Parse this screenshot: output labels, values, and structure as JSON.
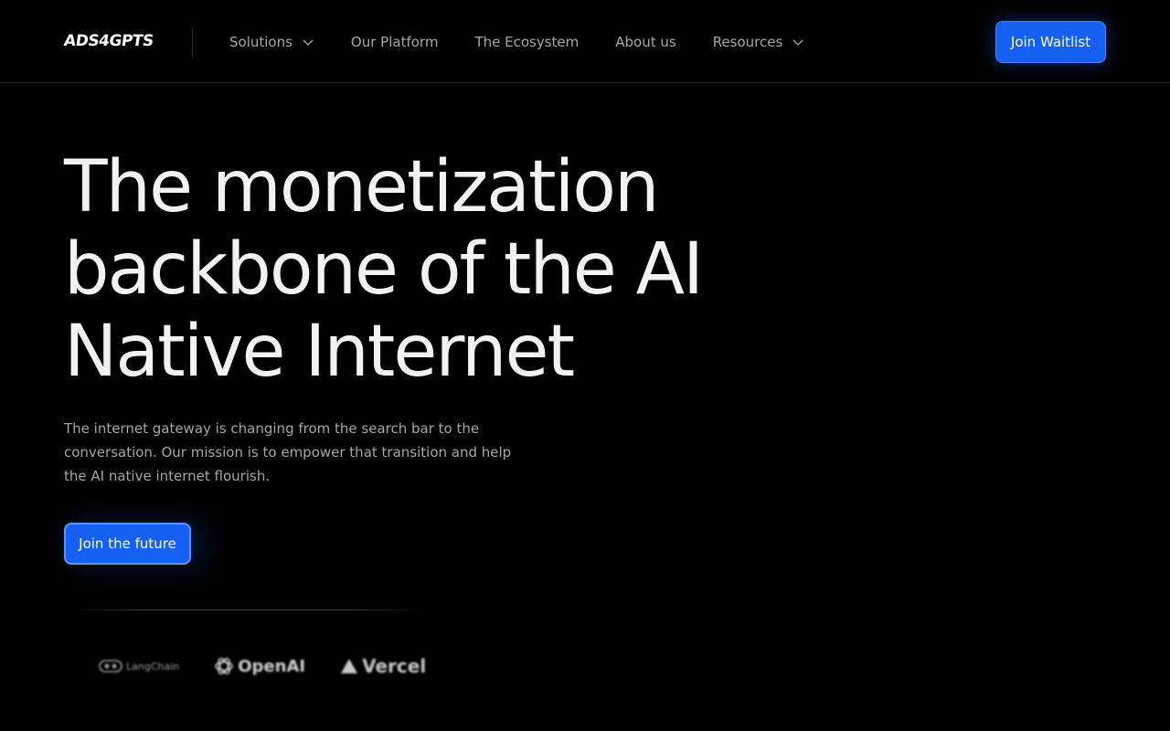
{
  "brand": {
    "logo_text": "ADS4GPTS",
    "accent_color": "#1560f3"
  },
  "nav": {
    "items": [
      {
        "label": "Solutions",
        "has_dropdown": true
      },
      {
        "label": "Our Platform",
        "has_dropdown": false
      },
      {
        "label": "The Ecosystem",
        "has_dropdown": false
      },
      {
        "label": "About us",
        "has_dropdown": false
      },
      {
        "label": "Resources",
        "has_dropdown": true
      }
    ],
    "cta_label": "Join Waitlist"
  },
  "hero": {
    "title_lines": [
      "The monetization",
      "backbone of the AI",
      "Native Internet"
    ],
    "subtitle": "The internet gateway is changing from the search bar to the conversation. Our mission is to empower that transition and help the AI native internet flourish.",
    "cta_label": "Join the future"
  },
  "partners": {
    "logos": [
      {
        "name": "LangChain",
        "icon": "langchain-icon"
      },
      {
        "name": "OpenAI",
        "icon": "openai-icon"
      },
      {
        "name": "Vercel",
        "icon": "vercel-icon"
      }
    ]
  }
}
